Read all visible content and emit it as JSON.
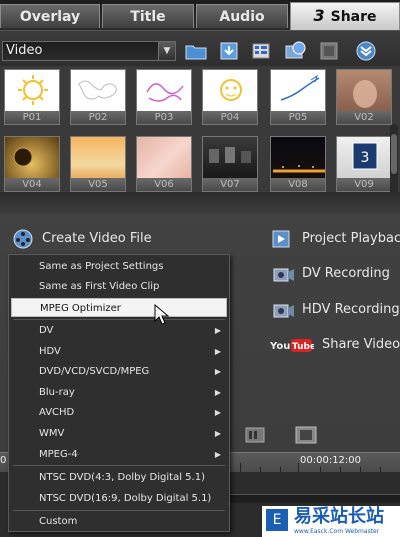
{
  "tabs": [
    {
      "label": "Overlay"
    },
    {
      "label": "Title"
    },
    {
      "label": "Audio"
    },
    {
      "number": "3",
      "label": "Share"
    }
  ],
  "library": {
    "dropdown_value": "Video",
    "thumbnails": [
      "P01",
      "P02",
      "P03",
      "P04",
      "P05",
      "V02",
      "V04",
      "V05",
      "V06",
      "V07",
      "V08",
      "V09"
    ]
  },
  "share_buttons": {
    "create_video_file": "Create Video File",
    "project_playback": "Project Playback",
    "dv_recording": "DV Recording",
    "hdv_recording": "HDV Recording",
    "share_video_online": "Share Video O"
  },
  "menu": {
    "items": [
      {
        "label": "Same as Project Settings"
      },
      {
        "label": "Same as First Video Clip"
      },
      {
        "label": "MPEG Optimizer"
      },
      {
        "label": "DV"
      },
      {
        "label": "HDV"
      },
      {
        "label": "DVD/VCD/SVCD/MPEG"
      },
      {
        "label": "Blu-ray"
      },
      {
        "label": "AVCHD"
      },
      {
        "label": "WMV"
      },
      {
        "label": "MPEG-4"
      },
      {
        "label": "NTSC DVD(4:3, Dolby Digital 5.1)"
      },
      {
        "label": "NTSC DVD(16:9, Dolby Digital 5.1)"
      },
      {
        "label": "Custom"
      }
    ]
  },
  "timeline": {
    "timecode_1": "00:00:12:00",
    "timecode_left": "0"
  },
  "watermark": {
    "title": "易采站长站",
    "subtitle": "www.Easck.Com Webmaster"
  }
}
